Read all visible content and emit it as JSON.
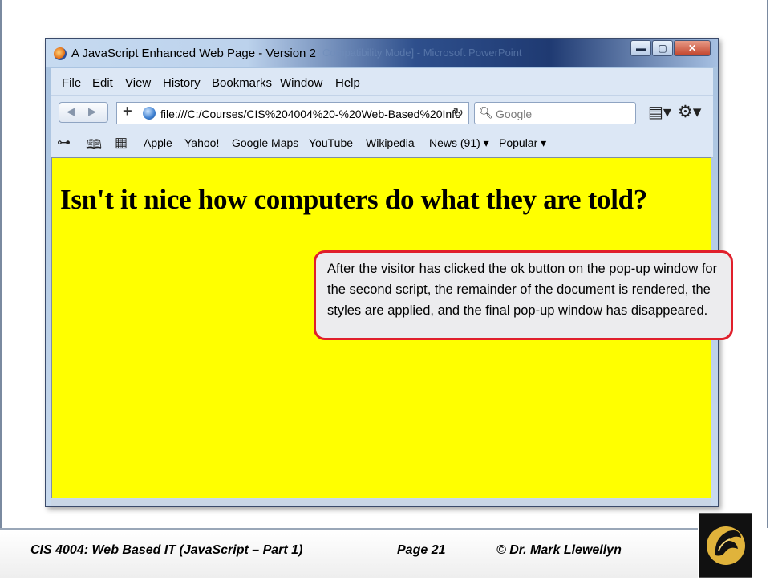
{
  "browser": {
    "window_title": "A JavaScript Enhanced Web Page - Version 2",
    "ghost_title": "Compatibility Mode] - Microsoft PowerPoint",
    "controls": {
      "min": "▬",
      "max": "▢",
      "close": "✕"
    },
    "menu": [
      "File",
      "Edit",
      "View",
      "History",
      "Bookmarks",
      "Window",
      "Help"
    ],
    "url": "file:///C:/Courses/CIS%204004%20-%20Web-Based%20Info",
    "search_placeholder": "Google",
    "bookmarks": [
      "Apple",
      "Yahoo!",
      "Google Maps",
      "YouTube",
      "Wikipedia",
      "News (91) ▾",
      "Popular ▾"
    ],
    "icons": {
      "back": "◀",
      "forward": "▶",
      "add": "+",
      "reload": "↻",
      "search": "🔍︎",
      "page": "▤▾",
      "gear": "⚙▾",
      "reader": "⊶",
      "book": "🕮︎",
      "grid": "▦"
    }
  },
  "page": {
    "heading": "Isn't it nice how computers do what they are told?",
    "background_color": "#ffff00"
  },
  "callout": {
    "text": "After the visitor has clicked the ok button on the pop-up window for the second script, the remainder of the document is rendered, the styles are applied, and the final pop-up window has disappeared."
  },
  "footer": {
    "course": "CIS 4004: Web Based IT (JavaScript – Part 1)",
    "page": "Page 21",
    "author": "© Dr. Mark Llewellyn"
  },
  "colors": {
    "callout_border": "#e01f2b",
    "page_yellow": "#ffff00",
    "logo_gold": "#e0b33b"
  }
}
